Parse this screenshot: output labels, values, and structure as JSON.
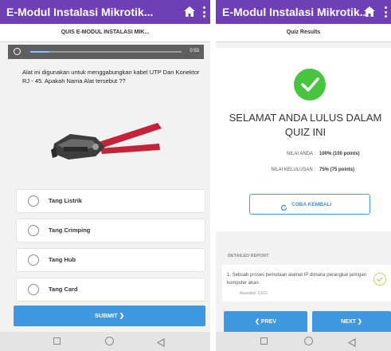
{
  "app": {
    "title": "E-Modul Instalasi Mikrotik...",
    "accent_color": "#6f3fb6",
    "button_color": "#3f98e0",
    "success_color": "#48c43f"
  },
  "left_screen": {
    "subheader": "QUIS E-MODUL INSTALASI MIK...",
    "timer": {
      "value_label": "0:53",
      "progress_fraction": 0.12
    },
    "question": "Alat ini digunakan untuk menggabungkan kabel UTP Dan Konektor RJ - 45. Apakah Nama Alat tersebut  ??",
    "image_subject": "crimping-tool",
    "options": [
      {
        "label": "Tang Listrik"
      },
      {
        "label": "Tang Crimping"
      },
      {
        "label": "Tang Hub"
      },
      {
        "label": "Tang Card"
      }
    ],
    "submit_label": "SUBMIT  ❯"
  },
  "right_screen": {
    "subheader": "Quiz Results",
    "result_title": "SELAMAT ANDA LULUS DALAM QUIZ INI",
    "score": {
      "label": "NILAI ANDA :",
      "value": "100% (100 points)"
    },
    "passing": {
      "label": "NILAI KELULUSAN :",
      "value": "75% (75 points)"
    },
    "retry_label": "COBA KEMBALI",
    "report": {
      "title": "DETAILED REPORT",
      "item_text": "1.  Sebuah proses pemetaan alamat IP dimana perangkat jaringan komputer akan",
      "awarded": "Awarded: 10/10"
    },
    "prev_label": "❮  PREV",
    "next_label": "NEXT  ❯"
  }
}
